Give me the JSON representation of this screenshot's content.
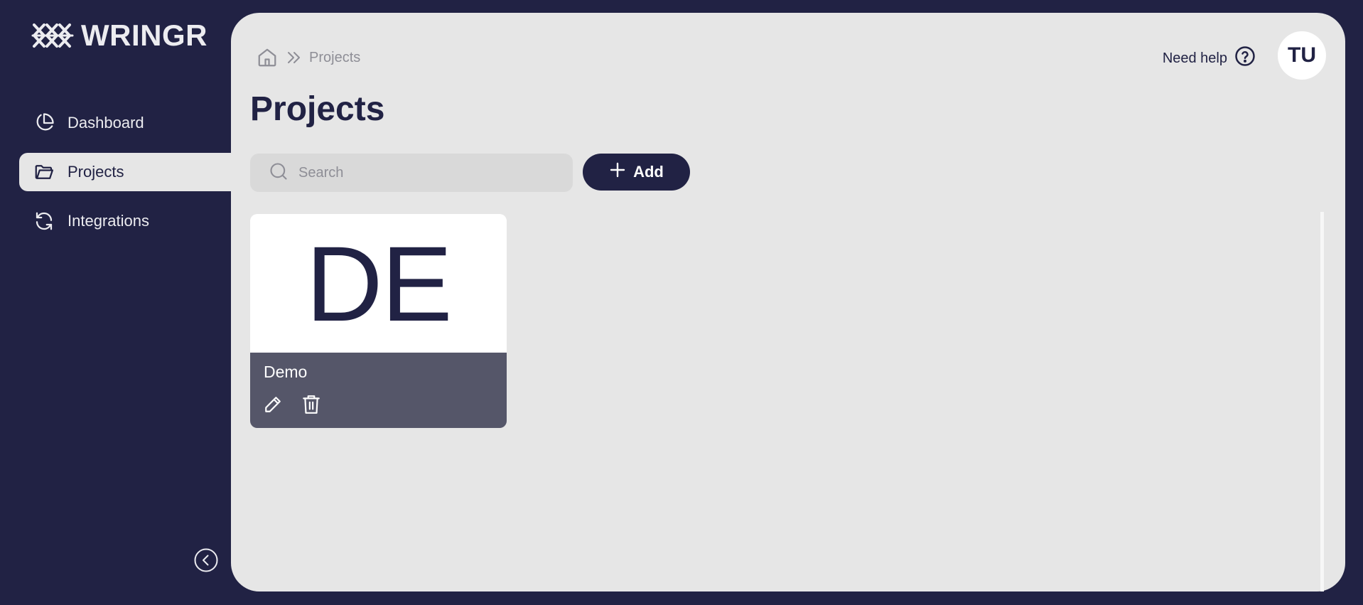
{
  "app": {
    "name": "WRINGR"
  },
  "sidebar": {
    "items": [
      {
        "label": "Dashboard",
        "icon": "pie-chart-icon",
        "active": false
      },
      {
        "label": "Projects",
        "icon": "folder-icon",
        "active": true
      },
      {
        "label": "Integrations",
        "icon": "refresh-icon",
        "active": false
      }
    ],
    "collapse_icon": "chevron-left-icon"
  },
  "header": {
    "breadcrumb": {
      "home_icon": "home-icon",
      "separator_icon": "double-chevron-right-icon",
      "current": "Projects"
    },
    "help_label": "Need help",
    "help_icon": "question-circle-icon",
    "avatar_initials": "TU"
  },
  "main": {
    "title": "Projects",
    "search": {
      "placeholder": "Search",
      "value": ""
    },
    "add_label": "Add",
    "projects": [
      {
        "initials": "DE",
        "name": "Demo",
        "actions": [
          "pencil-icon",
          "trash-icon"
        ]
      }
    ]
  },
  "colors": {
    "primary": "#212244",
    "panel": "#e6e6e6",
    "card_footer": "#555669",
    "search_bg": "#d9d9d9"
  }
}
